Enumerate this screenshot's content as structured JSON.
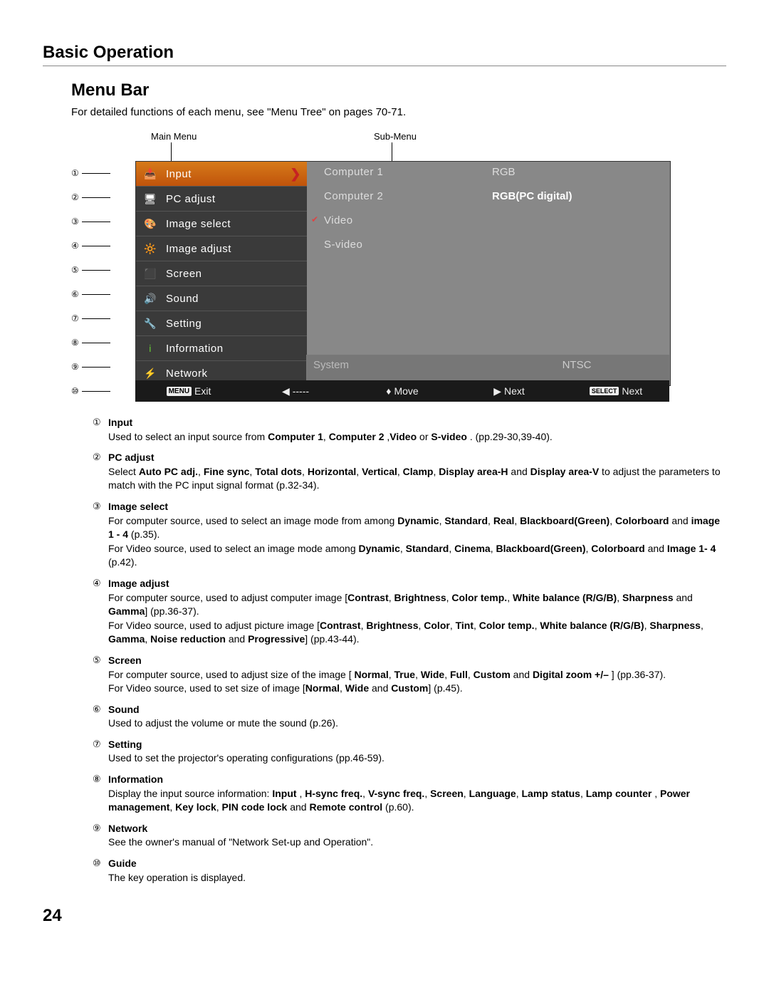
{
  "section_title": "Basic Operation",
  "sub_title": "Menu Bar",
  "intro": "For detailed functions of each menu, see \"Menu Tree\" on pages 70-71.",
  "labels": {
    "main": "Main Menu",
    "sub": "Sub-Menu"
  },
  "main_menu": [
    "Input",
    "PC adjust",
    "Image select",
    "Image adjust",
    "Screen",
    "Sound",
    "Setting",
    "Information",
    "Network"
  ],
  "sub_menu": [
    "Computer 1",
    "Computer 2",
    "Video",
    "S-video"
  ],
  "right_menu": [
    "RGB",
    "RGB(PC digital)"
  ],
  "system_label": "System",
  "ntsc_label": "NTSC",
  "guide": {
    "exit": "Exit",
    "dashes": "-----",
    "move": "Move",
    "next1": "Next",
    "next2": "Next",
    "menu_badge": "MENU",
    "select_badge": "SELECT"
  },
  "callouts": [
    "①",
    "②",
    "③",
    "④",
    "⑤",
    "⑥",
    "⑦",
    "⑧",
    "⑨",
    "⑩"
  ],
  "descriptions": [
    {
      "num": "①",
      "title": "Input",
      "body_html": "Used to select an input source from <span class='b'>Computer 1</span>, <span class='b'>Computer 2</span> ,<span class='b'>Video</span> or <span class='b'>S-video</span> . (pp.29-30,39-40)."
    },
    {
      "num": "②",
      "title": "PC adjust",
      "body_html": "Select <span class='b'>Auto PC adj.</span>, <span class='b'>Fine sync</span>, <span class='b'>Total dots</span>, <span class='b'>Horizontal</span>, <span class='b'>Vertical</span>, <span class='b'>Clamp</span>, <span class='b'>Display area-H</span> and <span class='b'>Display area-V</span> to adjust the parameters to match with the PC input signal format (p.32-34)."
    },
    {
      "num": "③",
      "title": "Image select",
      "body_html": "For computer source, used to select an image mode from among <span class='b'>Dynamic</span>, <span class='b'>Standard</span>, <span class='b'>Real</span>, <span class='b'>Blackboard(Green)</span>, <span class='b'>Colorboard</span> and <span class='b'>image 1 - 4</span> (p.35).<br>For Video source, used to select an image mode among <span class='b'>Dynamic</span>, <span class='b'>Standard</span>, <span class='b'>Cinema</span>, <span class='b'>Blackboard(Green)</span>, <span class='b'>Colorboard</span> and <span class='b'>Image 1- 4</span> (p.42)."
    },
    {
      "num": "④",
      "title": "Image adjust",
      "body_html": "For computer source, used to adjust computer image [<span class='b'>Contrast</span>, <span class='b'>Brightness</span>, <span class='b'>Color temp.</span>, <span class='b'>White balance (R/G/B)</span>, <span class='b'>Sharpness</span> and <span class='b'>Gamma</span>] (pp.36-37).<br>For Video source, used to adjust picture image [<span class='b'>Contrast</span>, <span class='b'>Brightness</span>, <span class='b'>Color</span>, <span class='b'>Tint</span>, <span class='b'>Color temp.</span>, <span class='b'>White balance (R/G/B)</span>, <span class='b'>Sharpness</span>, <span class='b'>Gamma</span>, <span class='b'>Noise reduction</span> and <span class='b'>Progressive</span>] (pp.43-44)."
    },
    {
      "num": "⑤",
      "title": "Screen",
      "body_html": "For computer source, used to adjust size of the image [ <span class='b'>Normal</span>, <span class='b'>True</span>, <span class='b'>Wide</span>, <span class='b'>Full</span>, <span class='b'>Custom</span> and <span class='b'>Digital zoom +/–</span> ] (pp.36-37).<br>For Video source, used to set size of image [<span class='b'>Normal</span>, <span class='b'>Wide</span> and <span class='b'>Custom</span>] (p.45)."
    },
    {
      "num": "⑥",
      "title": "Sound",
      "body_html": "Used to adjust the volume or mute the sound (p.26)."
    },
    {
      "num": "⑦",
      "title": "Setting",
      "body_html": "Used to set the projector's operating configurations (pp.46-59)."
    },
    {
      "num": "⑧",
      "title": "Information",
      "body_html": "Display the input source information: <span class='b'>Input</span> , <span class='b'>H-sync freq.</span>, <span class='b'>V-sync freq.</span>, <span class='b'>Screen</span>, <span class='b'>Language</span>, <span class='b'>Lamp status</span>, <span class='b'>Lamp counter</span> , <span class='b'>Power management</span>, <span class='b'>Key lock</span>, <span class='b'>PIN code lock</span> and <span class='b'>Remote control</span> (p.60)."
    },
    {
      "num": "⑨",
      "title": "Network",
      "body_html": "See the owner's manual of \"Network Set-up and Operation\"."
    },
    {
      "num": "⑩",
      "title": "Guide",
      "body_html": "The key operation is displayed."
    }
  ],
  "page_number": "24"
}
